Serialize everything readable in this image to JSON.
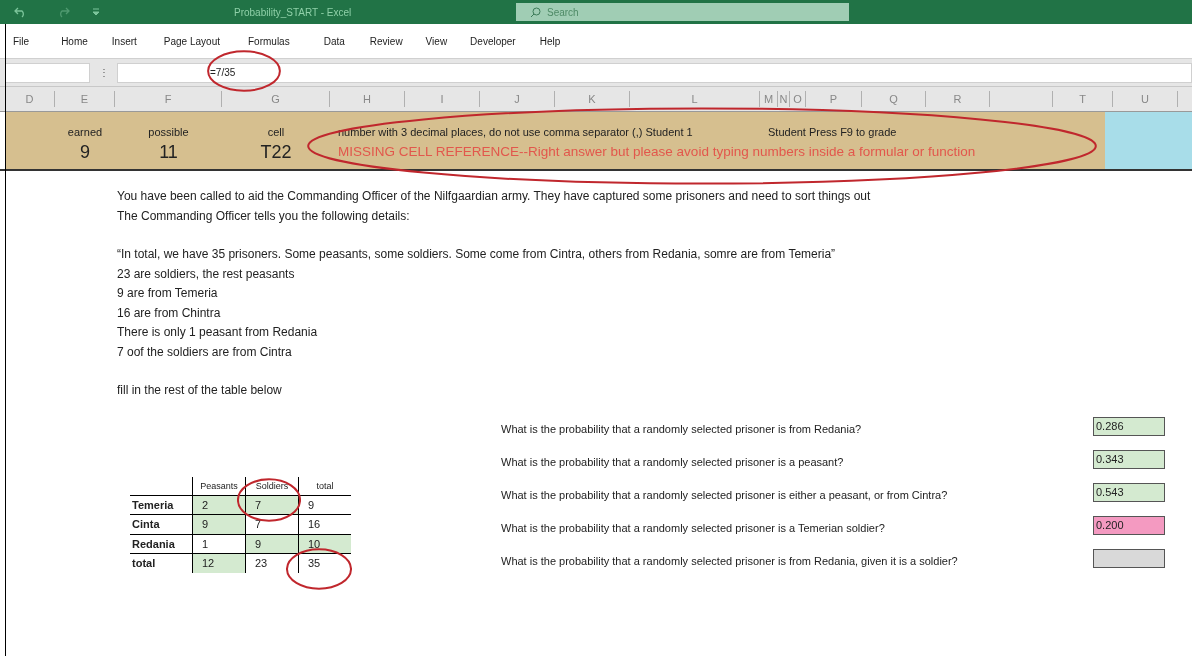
{
  "window": {
    "title": "Probability_START - Excel",
    "search_placeholder": "Search"
  },
  "menu": [
    "File",
    "Home",
    "Insert",
    "Page Layout",
    "Formulas",
    "Data",
    "Review",
    "View",
    "Developer",
    "Help"
  ],
  "formula_bar": {
    "separator": "⋮",
    "formula": "=7/35"
  },
  "columns": [
    "D",
    "E",
    "F",
    "G",
    "H",
    "I",
    "J",
    "K",
    "L",
    "M",
    "N",
    "O",
    "P",
    "Q",
    "R",
    "",
    "T",
    "U"
  ],
  "grade": {
    "earned_label": "earned",
    "earned": "9",
    "possible_label": "possible",
    "possible": "11",
    "cell_label": "cell",
    "cell": "T22",
    "instruction": "number with 3 decimal places, do not use comma separator (,) Student 1",
    "press": "Student Press F9 to grade",
    "feedback": "MISSING CELL REFERENCE--Right answer but please avoid typing numbers inside a formular or function"
  },
  "intro": [
    "You have been called to aid the Commanding Officer of the Nilfgaardian army. They have captured some prisoners and need to sort things out",
    "The Commanding Officer tells you the following details:"
  ],
  "details": [
    "“In total, we have 35 prisoners. Some peasants, some soldiers. Some come from Cintra, others from Redania, somre are from Temeria”",
    "23 are soldiers, the rest peasants",
    "9 are from Temeria",
    "16 are from Chintra",
    "There is only 1 peasant from Redania",
    "7 oof the soldiers are from Cintra"
  ],
  "task": "fill in the rest of the table below",
  "table": {
    "columns": [
      "Peasants",
      "Soldiers",
      "total"
    ],
    "rows": [
      {
        "label": "Temeria",
        "cells": [
          {
            "value": "2",
            "highlighted": true
          },
          {
            "value": "7",
            "highlighted": true
          },
          {
            "value": "9",
            "highlighted": false
          }
        ]
      },
      {
        "label": "Cinta",
        "cells": [
          {
            "value": "9",
            "highlighted": true
          },
          {
            "value": "7",
            "highlighted": false
          },
          {
            "value": "16",
            "highlighted": false
          }
        ]
      },
      {
        "label": "Redania",
        "cells": [
          {
            "value": "1",
            "highlighted": false
          },
          {
            "value": "9",
            "highlighted": true
          },
          {
            "value": "10",
            "highlighted": true
          }
        ]
      },
      {
        "label": "total",
        "cells": [
          {
            "value": "12",
            "highlighted": true
          },
          {
            "value": "23",
            "highlighted": false
          },
          {
            "value": "35",
            "highlighted": false
          }
        ]
      }
    ]
  },
  "questions": [
    {
      "text": "What is the probability that a randomly selected prisoner is from Redania?",
      "answer": "0.286",
      "kind": "correct"
    },
    {
      "text": "What is the probability that a randomly selected prisoner is a peasant?",
      "answer": "0.343",
      "kind": "correct"
    },
    {
      "text": "What is the probability that a randomly selected prisoner is either a peasant, or from Cintra?",
      "answer": "0.543",
      "kind": "correct"
    },
    {
      "text": "What is the probability that a randomly selected prisoner is a Temerian soldier?",
      "answer": "0.200",
      "kind": "wrong"
    },
    {
      "text": "What is the probability that a randomly selected prisoner is from Redania, given it is a soldier?",
      "kind": "empty"
    }
  ]
}
